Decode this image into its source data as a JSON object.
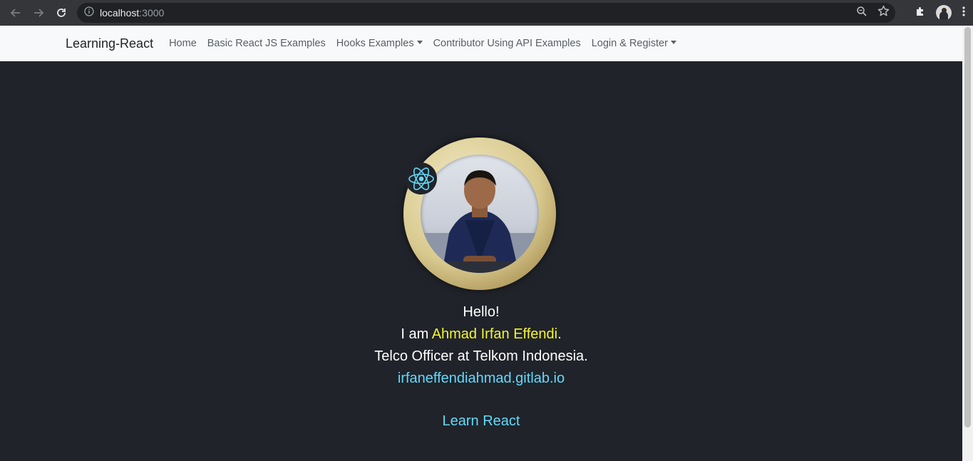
{
  "browser": {
    "url_host": "localhost",
    "url_port": ":3000",
    "icons": [
      "back-arrow-icon",
      "forward-arrow-icon",
      "reload-icon",
      "info-icon",
      "zoom-icon",
      "star-icon",
      "extensions-icon",
      "profile-avatar",
      "menu-kebab-icon"
    ]
  },
  "navbar": {
    "brand": "Learning-React",
    "links": [
      {
        "label": "Home",
        "dropdown": false
      },
      {
        "label": "Basic React JS Examples",
        "dropdown": false
      },
      {
        "label": "Hooks Examples",
        "dropdown": true
      },
      {
        "label": "Contributor Using API Examples",
        "dropdown": false
      },
      {
        "label": "Login & Register",
        "dropdown": true
      }
    ]
  },
  "hero": {
    "greeting": "Hello!",
    "intro_prefix": "I am ",
    "name": "Ahmad Irfan Effendi",
    "intro_suffix": ".",
    "role": "Telco Officer at Telkom Indonesia.",
    "website": "irfaneffendiahmad.gitlab.io",
    "cta": "Learn React"
  },
  "colors": {
    "page_bg": "#20232a",
    "highlight": "#f5f531",
    "link": "#61dafb",
    "navbar_bg": "#f8f9fa"
  }
}
